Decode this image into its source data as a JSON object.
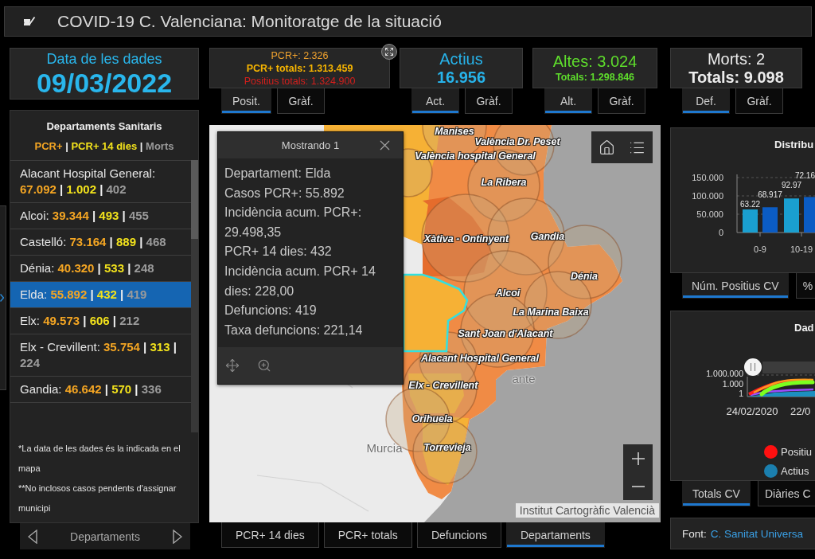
{
  "header": {
    "title": "COVID-19 C. Valenciana: Monitoratge de la situació"
  },
  "date_card": {
    "label": "Data de les dades",
    "value": "09/03/2022"
  },
  "stat_cards": [
    {
      "expand_button": true,
      "lines": [
        {
          "kind": "detail",
          "text": "PCR+: 2.326",
          "color": "#f0a22e"
        },
        {
          "kind": "detail_strong",
          "text": "PCR+ totals: 1.313.459",
          "color": "#f7b500"
        },
        {
          "kind": "detail",
          "text": "Positius totals: 1.324.900",
          "color": "#d61f1c"
        }
      ],
      "tabs": [
        {
          "label": "Posit.",
          "selected": true
        },
        {
          "label": "Gràf.",
          "selected": false
        }
      ]
    },
    {
      "expand_button": false,
      "lines": [
        {
          "kind": "headline",
          "text": "Actius",
          "color": "#27b3ea"
        },
        {
          "kind": "headline_strong",
          "text": "16.956",
          "color": "#27b3ea"
        }
      ],
      "tabs": [
        {
          "label": "Act.",
          "selected": true
        },
        {
          "label": "Gràf.",
          "selected": false
        }
      ]
    },
    {
      "expand_button": false,
      "lines": [
        {
          "kind": "headline",
          "text": "Altes: 3.024",
          "color": "#5edc2c"
        },
        {
          "kind": "detail_strong",
          "text": "Totals: 1.298.846",
          "color": "#5edc2c"
        }
      ],
      "tabs": [
        {
          "label": "Alt.",
          "selected": true
        },
        {
          "label": "Gràf.",
          "selected": false
        }
      ]
    },
    {
      "expand_button": false,
      "lines": [
        {
          "kind": "headline",
          "text": "Morts: 2",
          "color": "#ececec"
        },
        {
          "kind": "headline_strong",
          "text": "Totals: 9.098",
          "color": "#ececec"
        }
      ],
      "tabs": [
        {
          "label": "Def.",
          "selected": true
        },
        {
          "label": "Gràf.",
          "selected": false
        }
      ]
    }
  ],
  "departments_panel": {
    "title": "Departaments Sanitaris",
    "separator": "|",
    "legend": [
      {
        "text": "PCR+",
        "color": "#f5a623"
      },
      {
        "text": "PCR+ 14 dies",
        "color": "#f2e21c"
      },
      {
        "text": "Morts",
        "color": "#9b9b9b"
      }
    ],
    "items": [
      {
        "label": "Alacant Hospital General:",
        "values": [
          "67.092",
          "1.002",
          "402"
        ],
        "selected": false
      },
      {
        "label": "Alcoi:",
        "values": [
          "39.344",
          "493",
          "455"
        ],
        "selected": false
      },
      {
        "label": "Castelló:",
        "values": [
          "73.164",
          "889",
          "468"
        ],
        "selected": false
      },
      {
        "label": "Dénia:",
        "values": [
          "40.320",
          "533",
          "248"
        ],
        "selected": false
      },
      {
        "label": "Elda:",
        "values": [
          "55.892",
          "432",
          "419"
        ],
        "selected": true
      },
      {
        "label": "Elx:",
        "values": [
          "49.573",
          "606",
          "212"
        ],
        "selected": false
      },
      {
        "label": "Elx - Crevillent:",
        "values": [
          "35.754",
          "313",
          "224"
        ],
        "selected": false
      },
      {
        "label": "Gandia:",
        "values": [
          "46.642",
          "570",
          "336"
        ],
        "selected": false
      }
    ],
    "notes": [
      "*La data de les dades és la indicada en el mapa",
      "**No inclosos casos pendents d'assignar municipi"
    ],
    "pager": {
      "label": "Departaments"
    }
  },
  "map": {
    "labels": [
      {
        "text": "Manises",
        "kind": "department"
      },
      {
        "text": "València Dr. Peset",
        "kind": "department"
      },
      {
        "text": "València hospital General",
        "kind": "department"
      },
      {
        "text": "La Ribera",
        "kind": "department"
      },
      {
        "text": "Xàtiva - Ontinyent",
        "kind": "department"
      },
      {
        "text": "Gandia",
        "kind": "department"
      },
      {
        "text": "Dénia",
        "kind": "department"
      },
      {
        "text": "Alcoi",
        "kind": "department"
      },
      {
        "text": "La Marina Baixa",
        "kind": "department"
      },
      {
        "text": "Sant Joan d'Alacant",
        "kind": "department"
      },
      {
        "text": "Alacant Hospital General",
        "kind": "department"
      },
      {
        "text": "Elx - Crevillent",
        "kind": "department"
      },
      {
        "text": "Orihuela",
        "kind": "department"
      },
      {
        "text": "Torrevieja",
        "kind": "department"
      },
      {
        "text": "Murcia",
        "kind": "place"
      },
      {
        "text": "ante",
        "kind": "place"
      }
    ],
    "attribution": "Institut Cartogràfic Valencià",
    "popup": {
      "title": "Mostrando 1",
      "fields": [
        "Departament: Elda",
        "Casos PCR+: 55.892",
        "Incidència acum. PCR+: 29.498,35",
        "PCR+ 14 dies: 432",
        "Incidència acum. PCR+ 14 dies: 228,00",
        "Defuncions: 419",
        "Taxa defuncions: 221,14"
      ]
    },
    "tabs": [
      {
        "label": "PCR+ 14 dies",
        "selected": false
      },
      {
        "label": "PCR+ totals",
        "selected": false
      },
      {
        "label": "Defuncions",
        "selected": false
      },
      {
        "label": "Departaments",
        "selected": true
      }
    ]
  },
  "age_chart_panel": {
    "title": "Distribu",
    "chart_data": {
      "type": "bar",
      "categories": [
        "0-9",
        "10-19"
      ],
      "series": [
        {
          "color": "#1a9fd0",
          "values": [
            63000,
            93000
          ]
        },
        {
          "color": "#0b5cc4",
          "values": [
            69000,
            97000
          ]
        }
      ],
      "ylim": [
        0,
        150000
      ],
      "yticks": [
        {
          "value": 0,
          "label": "0"
        },
        {
          "value": 50000,
          "label": "50.000"
        },
        {
          "value": 100000,
          "label": "100.000"
        },
        {
          "value": 150000,
          "label": "150.000"
        }
      ],
      "value_labels": [
        [
          "63.22",
          "92.97"
        ],
        [
          "68.917",
          "72.16"
        ]
      ]
    },
    "tabs": [
      {
        "label": "Núm. Positius CV",
        "selected": true
      },
      {
        "label": "%",
        "selected": false
      }
    ]
  },
  "timeline_panel": {
    "title": "Dad",
    "y_labels": [
      "1.000.000",
      "1.000",
      "1"
    ],
    "x_labels": [
      "24/02/2020",
      "22/0"
    ],
    "legend": [
      {
        "label": "Positiu",
        "color": "#ff1010"
      },
      {
        "label": "Actius",
        "color": "#1b7fae"
      }
    ],
    "tabs": [
      {
        "label": "Totals CV",
        "selected": true
      },
      {
        "label": "Diàries C",
        "selected": false
      }
    ]
  },
  "source": {
    "label": "Font:",
    "link": "C. Sanitat Universa"
  }
}
